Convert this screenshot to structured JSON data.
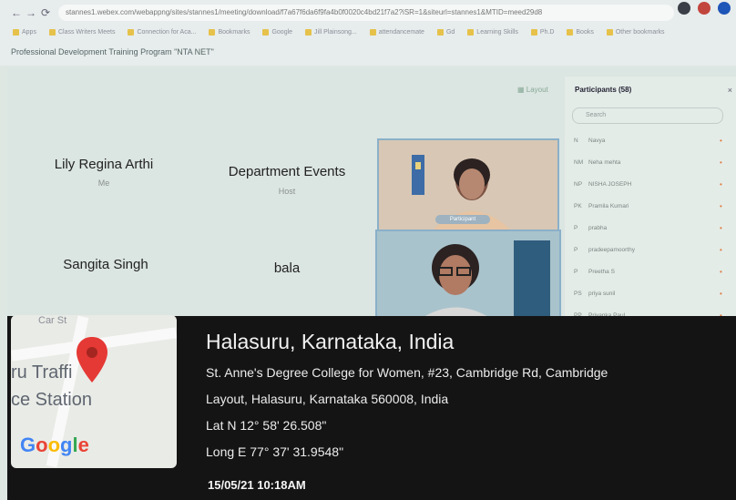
{
  "browser": {
    "url": "stannes1.webex.com/webappng/sites/stannes1/meeting/download/f7a67f6da6f9fa4b0f0020c4bd21f7a2?iSR=1&siteurl=stannes1&MTID=meed29d8",
    "bookmarks": [
      "Apps",
      "Class Writers Meets",
      "Connection for Aca...",
      "Bookmarks",
      "Google",
      "Jill Plainsong...",
      "attendancemate",
      "Gd",
      "Learning Skills",
      "Ph.D",
      "Books",
      "Other bookmarks"
    ],
    "page_title": "Professional Development Training Program \"NTA NET\""
  },
  "meeting": {
    "layout_label": "Layout",
    "tiles": [
      {
        "name": "Lily Regina Arthi",
        "sub": "Me"
      },
      {
        "name": "Department Events",
        "sub": "Host"
      },
      {
        "name": "Sangita Singh",
        "sub": ""
      },
      {
        "name": "bala",
        "sub": ""
      }
    ],
    "video_tag": "Participant"
  },
  "participants": {
    "title": "Participants (58)",
    "search_placeholder": "Search",
    "items": [
      {
        "initials": "N",
        "name": "Navya"
      },
      {
        "initials": "NM",
        "name": "Neha mehta"
      },
      {
        "initials": "NP",
        "name": "NISHA JOSEPH"
      },
      {
        "initials": "PK",
        "name": "Pramila Kumari"
      },
      {
        "initials": "P",
        "name": "prabha"
      },
      {
        "initials": "P",
        "name": "pradeepamoorthy"
      },
      {
        "initials": "P",
        "name": "Preetha S"
      },
      {
        "initials": "PS",
        "name": "priya sunil"
      },
      {
        "initials": "PP",
        "name": "Priyanka Paul"
      }
    ]
  },
  "map": {
    "street_label": "Car St",
    "poi_label_line1": "ru Traffi",
    "poi_label_line2": "ce Station",
    "logo": "Google"
  },
  "location": {
    "title": "Halasuru, Karnataka, India",
    "address_line1": "St. Anne's Degree College for Women, #23, Cambridge Rd, Cambridge",
    "address_line2": "Layout, Halasuru, Karnataka 560008, India",
    "lat": "Lat N 12° 58' 26.508\"",
    "long": "Long E 77° 37' 31.9548\"",
    "timestamp": "15/05/21 10:18AM"
  },
  "colors": {
    "overlay_bg": "#141414",
    "pin": "#e53935",
    "accent_mic": "#e07a3c"
  }
}
